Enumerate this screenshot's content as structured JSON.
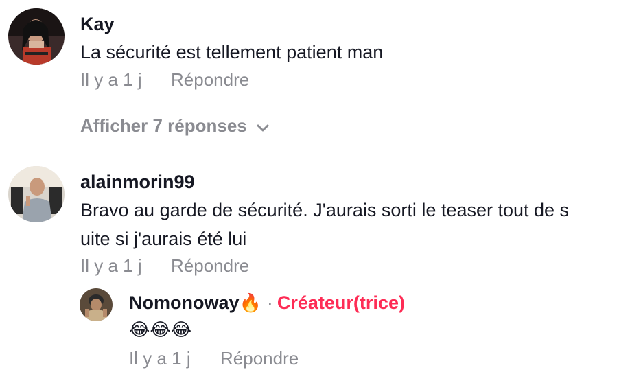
{
  "comments": [
    {
      "username": "Kay",
      "text": "La sécurité est tellement patient man",
      "time": "Il y a 1 j",
      "reply_label": "Répondre",
      "view_replies_label": "Afficher 7 réponses"
    },
    {
      "username": "alainmorin99",
      "text_line1": "Bravo au garde de sécurité. J'aurais sorti le teaser tout de s",
      "text_line2": "uite si j'aurais été lui",
      "time": "Il y a 1 j",
      "reply_label": "Répondre",
      "reply": {
        "username": "Nomonoway",
        "username_emoji": "🔥",
        "separator": "·",
        "badge": "Créateur(trice)",
        "text": "😂😂😂",
        "time": "Il y a 1 j",
        "reply_label": "Répondre"
      }
    }
  ],
  "colors": {
    "primary_text": "#161823",
    "secondary_text": "#8a8b91",
    "creator_badge": "#fe2c55"
  },
  "icons": {
    "view_replies": "chevron-down-icon",
    "flame": "fire-emoji"
  }
}
